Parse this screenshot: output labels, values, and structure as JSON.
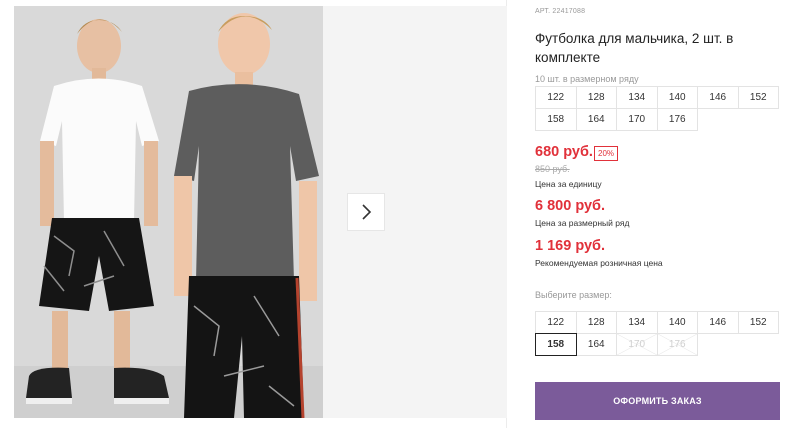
{
  "product": {
    "article": "АРТ. 22417088",
    "title": "Футболка для мальчика, 2 шт. в комплекте"
  },
  "size_range": {
    "caption": "10 шт. в размерном ряду",
    "rows": [
      [
        "122",
        "128",
        "134",
        "140",
        "146",
        "152"
      ],
      [
        "158",
        "164",
        "170",
        "176"
      ]
    ]
  },
  "pricing": {
    "unit_price": "680 руб.",
    "discount": "20%",
    "old_price": "850 руб.",
    "unit_note": "Цена за единицу",
    "range_price": "6 800 руб.",
    "range_note": "Цена за размерный ряд",
    "retail_price": "1 169 руб.",
    "retail_note": "Рекомендуемая розничная цена"
  },
  "size_select": {
    "caption": "Выберите размер:",
    "rows": [
      [
        {
          "label": "122",
          "state": "normal"
        },
        {
          "label": "128",
          "state": "normal"
        },
        {
          "label": "134",
          "state": "normal"
        },
        {
          "label": "140",
          "state": "normal"
        },
        {
          "label": "146",
          "state": "normal"
        },
        {
          "label": "152",
          "state": "normal"
        }
      ],
      [
        {
          "label": "158",
          "state": "selected"
        },
        {
          "label": "164",
          "state": "normal"
        },
        {
          "label": "170",
          "state": "disabled"
        },
        {
          "label": "176",
          "state": "disabled"
        }
      ]
    ]
  },
  "actions": {
    "order_label": "ОФОРМИТЬ ЗАКАЗ"
  },
  "gallery": {
    "next_icon": "chevron-right-icon"
  },
  "colors": {
    "price": "#e1313a",
    "order_button": "#7b5b9a"
  }
}
